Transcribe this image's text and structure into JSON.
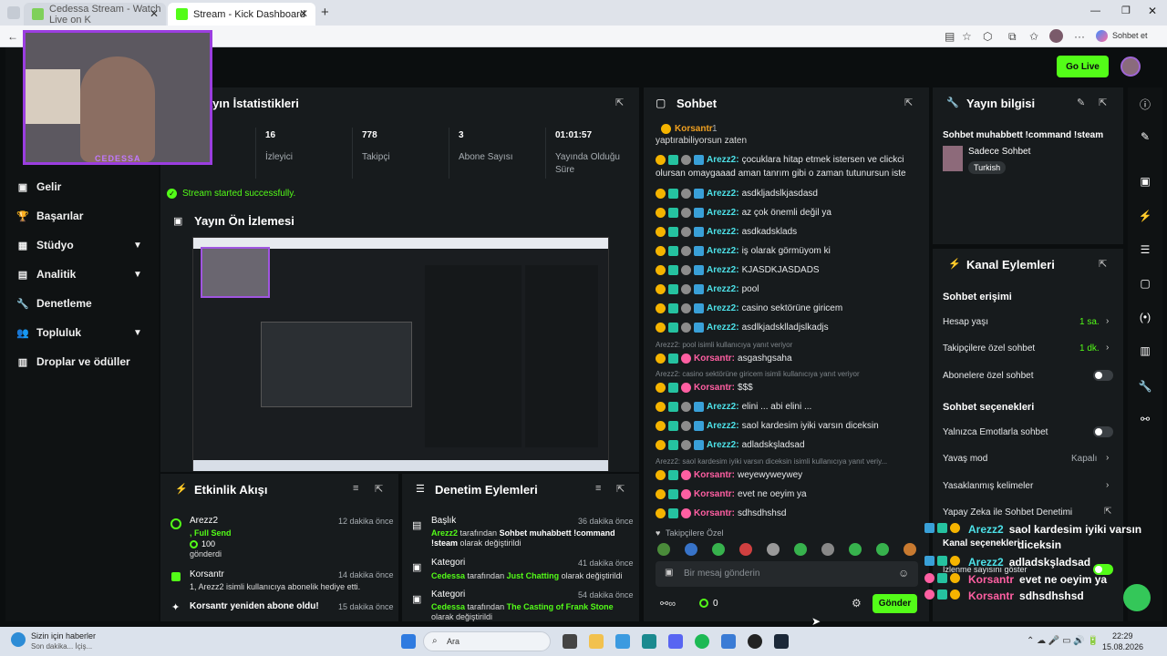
{
  "browser": {
    "tabs": [
      {
        "title": "Cedessa Stream - Watch Live on K"
      },
      {
        "title": "Stream - Kick Dashboard"
      }
    ],
    "profile_label": "Sohbet et"
  },
  "header": {
    "go_live": "Go Live"
  },
  "sidebar": {
    "items": [
      {
        "label": "Gelir"
      },
      {
        "label": "Başarılar"
      },
      {
        "label": "Stüdyo"
      },
      {
        "label": "Analitik"
      },
      {
        "label": "Denetleme"
      },
      {
        "label": "Topluluk"
      },
      {
        "label": "Droplar ve ödüller"
      }
    ]
  },
  "stats": {
    "title": "Yayın İstatistikleri",
    "items": [
      {
        "value": "16",
        "label": "İzleyici"
      },
      {
        "value": "778",
        "label": "Takipçi"
      },
      {
        "value": "3",
        "label": "Abone Sayısı"
      },
      {
        "value": "01:01:57",
        "label": "Yayında Olduğu Süre"
      }
    ],
    "status": "Stream started successfully."
  },
  "preview": {
    "title": "Yayın Ön İzlemesi"
  },
  "activity": {
    "title": "Etkinlik Akışı",
    "items": [
      {
        "user": "Arezz2",
        "line1": ", Full Send",
        "amount": "100",
        "line2": "gönderdi",
        "time": "12 dakika önce"
      },
      {
        "user": "Korsantr",
        "line1": "1, Arezz2 isimli kullanıcıya abonelik hediye etti.",
        "time": "14 dakika önce"
      },
      {
        "user": "Korsantr yeniden abone oldu!",
        "time": "15 dakika önce"
      }
    ]
  },
  "mod": {
    "title": "Denetim Eylemleri",
    "items": [
      {
        "type": "Başlık",
        "time": "36 dakika önce",
        "user": "Arezz2",
        "mid": "tarafından",
        "value": "Sohbet muhabbett !command !steam",
        "tail": "olarak değiştirildi"
      },
      {
        "type": "Kategori",
        "time": "41 dakika önce",
        "user": "Cedessa",
        "mid": "tarafından",
        "value": "Just Chatting",
        "tail": "olarak değiştirildi"
      },
      {
        "type": "Kategori",
        "time": "54 dakika önce",
        "user": "Cedessa",
        "mid": "tarafından",
        "value": "The Casting of Frank Stone",
        "tail": "olarak değiştirildi"
      }
    ]
  },
  "chat": {
    "title": "Sohbet",
    "pinned_user": "Korsantr",
    "pinned_count": "1",
    "top_fragment": "yaptırabiliyorsun zaten",
    "messages": [
      {
        "user": "Arezz2:",
        "text": "çocuklara hitap etmek istersen ve clickci",
        "cont": "olursan omaygaaad aman tanrım gibi o zaman tutunursun iste",
        "color": "#4de1e8"
      },
      {
        "user": "Arezz2:",
        "text": "asdkljadslkjasdasd",
        "color": "#4de1e8"
      },
      {
        "user": "Arezz2:",
        "text": "az çok önemli değil ya",
        "color": "#4de1e8"
      },
      {
        "user": "Arezz2:",
        "text": "asdkadsklads",
        "color": "#4de1e8"
      },
      {
        "user": "Arezz2:",
        "text": "iş olarak görmüyom ki",
        "color": "#4de1e8"
      },
      {
        "user": "Arezz2:",
        "text": "KJASDKJASDADS",
        "color": "#4de1e8"
      },
      {
        "user": "Arezz2:",
        "text": "pool",
        "color": "#4de1e8"
      },
      {
        "user": "Arezz2:",
        "text": "casino sektörüne giricem",
        "color": "#4de1e8"
      },
      {
        "user": "Arezz2:",
        "text": "asdlkjadsklladjslkadjs",
        "color": "#4de1e8"
      },
      {
        "reply": "Arezz2: pool isimli kullanıcıya yanıt veriyor",
        "user": "Korsantr:",
        "text": "asgashgsaha",
        "color": "#ff5fa2"
      },
      {
        "reply": "Arezz2: casino sektörüne giricem isimli kullanıcıya yanıt veriyor",
        "user": "Korsantr:",
        "text": "$$$",
        "color": "#ff5fa2"
      },
      {
        "user": "Arezz2:",
        "text": "elini ... abi elini ...",
        "color": "#4de1e8"
      },
      {
        "user": "Arezz2:",
        "text": "saol kardesim iyiki varsın diceksin",
        "color": "#4de1e8"
      },
      {
        "user": "Arezz2:",
        "text": "adladskşladsad",
        "color": "#4de1e8"
      },
      {
        "reply": "Arezz2: saol kardesim iyiki varsın diceksin isimli kullanıcıya yanıt veriy...",
        "user": "Korsantr:",
        "text": "weyewyweywey",
        "color": "#ff5fa2"
      },
      {
        "user": "Korsantr:",
        "text": "evet ne oeyim ya",
        "color": "#ff5fa2"
      },
      {
        "user": "Korsantr:",
        "text": "sdhsdhshsd",
        "color": "#ff5fa2"
      }
    ],
    "followers_only": "Takipçilere Özel",
    "placeholder": "Bir mesaj gönderin",
    "count": "0",
    "send": "Gönder"
  },
  "info": {
    "title": "Yayın bilgisi",
    "stream_title": "Sohbet muhabbett !command !steam",
    "category": "Sadece Sohbet",
    "language": "Turkish"
  },
  "actions": {
    "title": "Kanal Eylemleri",
    "section1": "Sohbet erişimi",
    "account_age": "Hesap yaşı",
    "account_age_val": "1 sa.",
    "followers": "Takipçilere özel sohbet",
    "followers_val": "1 dk.",
    "subs": "Abonelere özel sohbet",
    "section2": "Sohbet seçenekleri",
    "emotes": "Yalnızca Emotlarla sohbet",
    "slow": "Yavaş mod",
    "slow_val": "Kapalı",
    "banned": "Yasaklanmış kelimeler",
    "ai": "Yapay Zeka ile Sohbet Denetimi",
    "selections": "Kanal seçenekleri",
    "viewers": "İzlenme sayısını göster"
  },
  "overlay": {
    "lines": [
      {
        "user": "Arezz2",
        "text": "saol kardesim iyiki varsın"
      },
      {
        "user": "",
        "text": "diceksin"
      },
      {
        "user": "Arezz2",
        "text": "adladskşladsad"
      },
      {
        "user": "Korsantr",
        "text": "evet ne oeyim ya"
      },
      {
        "user": "Korsantr",
        "text": "sdhsdhshsd"
      }
    ],
    "webcam_name": "CEDESSA"
  },
  "taskbar": {
    "news_title": "Sizin için haberler",
    "news_sub": "Son dakika... İçiş...",
    "search": "Ara",
    "time": "22:29",
    "date": "15.08.2026"
  }
}
